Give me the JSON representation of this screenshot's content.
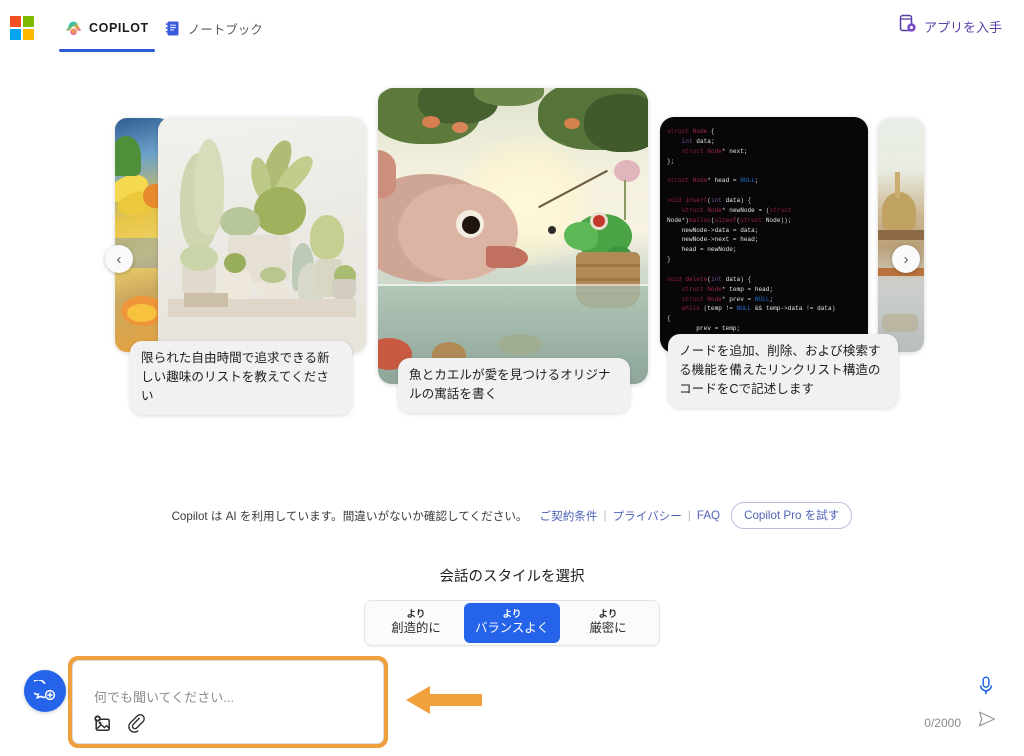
{
  "header": {
    "logo_name": "microsoft-logo",
    "tabs": [
      {
        "id": "copilot",
        "label": "COPILOT",
        "icon": "copilot-icon",
        "active": true
      },
      {
        "id": "notebook",
        "label": "ノートブック",
        "icon": "notebook-icon",
        "active": false
      }
    ],
    "get_app": {
      "label": "アプリを入手",
      "icon": "mobile-app-icon"
    }
  },
  "carousel": {
    "prev_label": "‹",
    "next_label": "›",
    "cards": [
      {
        "id": "edge-left",
        "art": "fruit-still-life",
        "caption": ""
      },
      {
        "id": "plants",
        "art": "potted-plants",
        "caption": "限られた自由時間で追求できる新しい趣味のリストを教えてください"
      },
      {
        "id": "fable",
        "art": "fish-and-frog",
        "caption": "魚とカエルが愛を見つけるオリジナルの寓話を書く"
      },
      {
        "id": "code",
        "art": "c-code-dark",
        "caption": "ノードを追加、削除、および検索する機能を備えたリンクリスト構造のコードをCで記述します"
      },
      {
        "id": "edge-right",
        "art": "temple-scene",
        "caption": ""
      }
    ],
    "code_snippet": "struct Node {\n    int data;\n    struct Node* next;\n};\n\nstruct Node* head = NULL;\n\nvoid insert(int data) {\n    struct Node* newNode = (struct\nNode*)malloc(sizeof(struct Node));\n    newNode->data = data;\n    newNode->next = head;\n    head = newNode;\n}\n\nvoid delete(int data) {\n    struct Node* temp = head;\n    struct Node* prev = NULL;\n    while (temp != NULL && temp->data != data)\n{\n        prev = temp;"
  },
  "disclaimer": {
    "text": "Copilot は AI を利用しています。間違いがないか確認してください。",
    "terms_label": "ご契約条件",
    "privacy_label": "プライバシー",
    "faq_label": "FAQ",
    "pro_button_label": "Copilot Pro を試す"
  },
  "style_picker": {
    "title": "会話のスタイルを選択",
    "options": [
      {
        "id": "creative",
        "top": "より",
        "bottom": "創造的に",
        "selected": false
      },
      {
        "id": "balanced",
        "top": "より",
        "bottom": "バランスよく",
        "selected": true
      },
      {
        "id": "precise",
        "top": "より",
        "bottom": "厳密に",
        "selected": false
      }
    ],
    "selected_color": "#2563eb"
  },
  "composer": {
    "placeholder": "何でも聞いてください...",
    "value": "",
    "counter": "0/2000",
    "image_tool_name": "add-image-icon",
    "attach_tool_name": "attachment-icon",
    "mic_name": "microphone-icon",
    "send_name": "send-icon",
    "highlight_color": "#f0a03c"
  },
  "new_chat": {
    "name": "new-chat-button",
    "icon": "new-chat-icon",
    "color": "#2563eb"
  },
  "annotation": {
    "name": "orange-pointer-arrow",
    "color": "#f0a03c",
    "direction": "left"
  }
}
